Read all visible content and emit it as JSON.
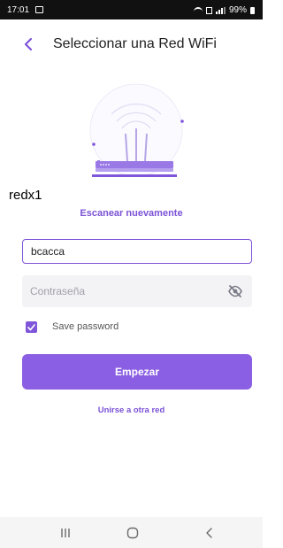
{
  "status_bar": {
    "time": "17:01",
    "battery_text": "99%"
  },
  "header": {
    "title": "Seleccionar una Red WiFi",
    "back_icon": "chevron-left-icon"
  },
  "illustration": {
    "icon": "wifi-router-illustration"
  },
  "overlay_label": "redx1",
  "rescan": {
    "label": "Escanear nuevamente"
  },
  "form": {
    "ssid_value": "bcacca",
    "password_placeholder": "Contraseña",
    "password_value": "",
    "eye_icon": "eye-off-icon",
    "save_password_label": "Save password",
    "save_password_checked": true
  },
  "actions": {
    "start_label": "Empezar",
    "other_network_label": "Unirse a otra red"
  },
  "colors": {
    "accent": "#7f55d9",
    "button": "#8a5fe3",
    "status_bar": "#111111"
  },
  "nav_bar": {
    "recents_icon": "recents-icon",
    "home_icon": "home-icon",
    "back_icon": "back-icon"
  }
}
